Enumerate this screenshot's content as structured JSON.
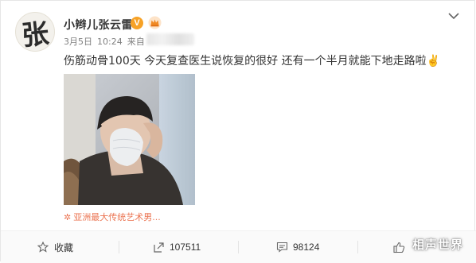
{
  "post": {
    "avatar_char": "张",
    "author": "小辫儿张云雷",
    "verified_badge": "V",
    "date": "3月5日",
    "time": "10:24",
    "via_prefix": "来自",
    "text": "伤筋动骨100天 今天复查医生说恢复的很好 还有一个半月就能下地走路啦✌️",
    "source_label": "亚洲最大传统艺术男..."
  },
  "actions": {
    "favorite_label": "收藏",
    "repost_count": "107511",
    "comment_count": "98124",
    "like_icon": "thumbs-up-icon"
  },
  "watermark": "相声世界",
  "colors": {
    "accent": "#eb7350",
    "badge": "#f7a226",
    "muted": "#808080"
  }
}
